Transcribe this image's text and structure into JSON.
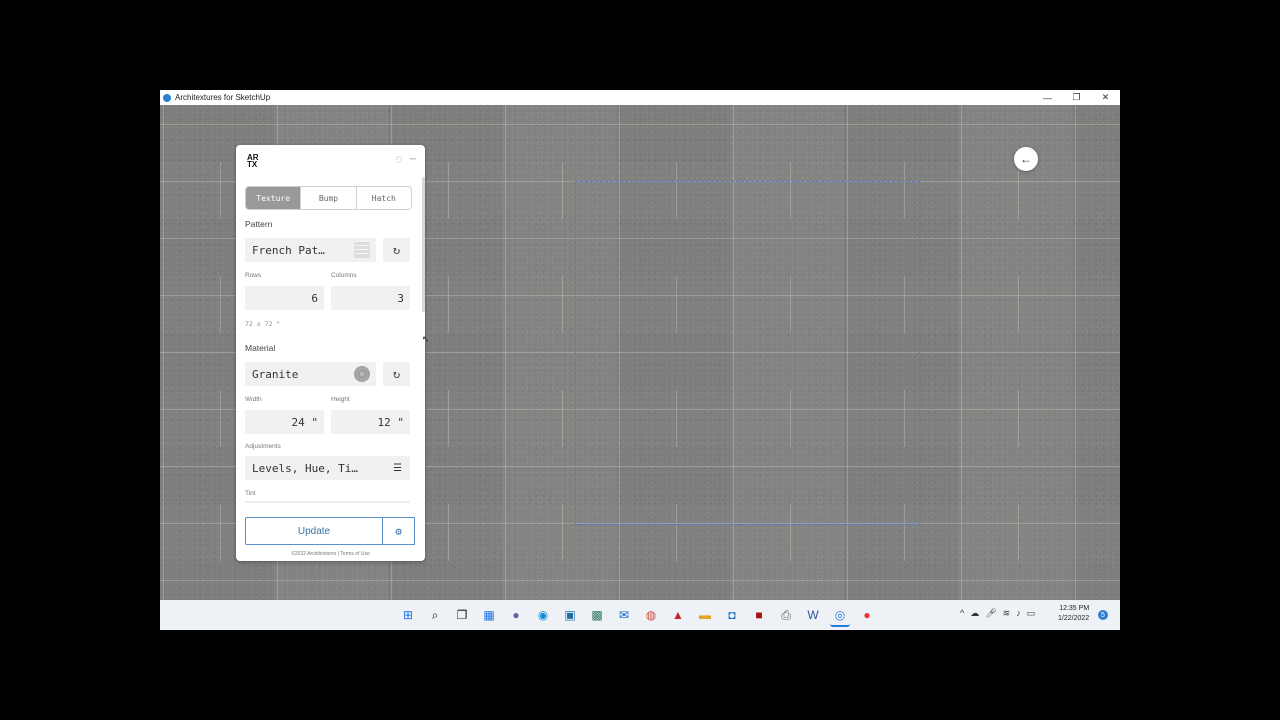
{
  "window": {
    "title": "Architextures for SketchUp",
    "controls": [
      "—",
      "❐",
      "✕"
    ]
  },
  "panel": {
    "logo_top": "AR",
    "logo_bottom": "TX",
    "tabs": [
      {
        "label": "Texture",
        "active": true
      },
      {
        "label": "Bump"
      },
      {
        "label": "Hatch"
      }
    ],
    "pattern": {
      "label": "Pattern",
      "value": "French Pat…",
      "rows_label": "Rows",
      "rows": "6",
      "columns_label": "Columns",
      "columns": "3",
      "dims": "72 x 72 \""
    },
    "material": {
      "label": "Material",
      "value": "Granite",
      "width_label": "Width",
      "width": "24 \"",
      "height_label": "Height",
      "height": "12 \""
    },
    "adjustments": {
      "label": "Adjustments",
      "value": "Levels, Hue, Ti…"
    },
    "tint_label": "Tint",
    "update_label": "Update",
    "footer": "©2022 Architextures | Terms of Use"
  },
  "taskbar": {
    "clock_time": "12:35 PM",
    "clock_date": "1/22/2022",
    "notification_count": "5"
  }
}
